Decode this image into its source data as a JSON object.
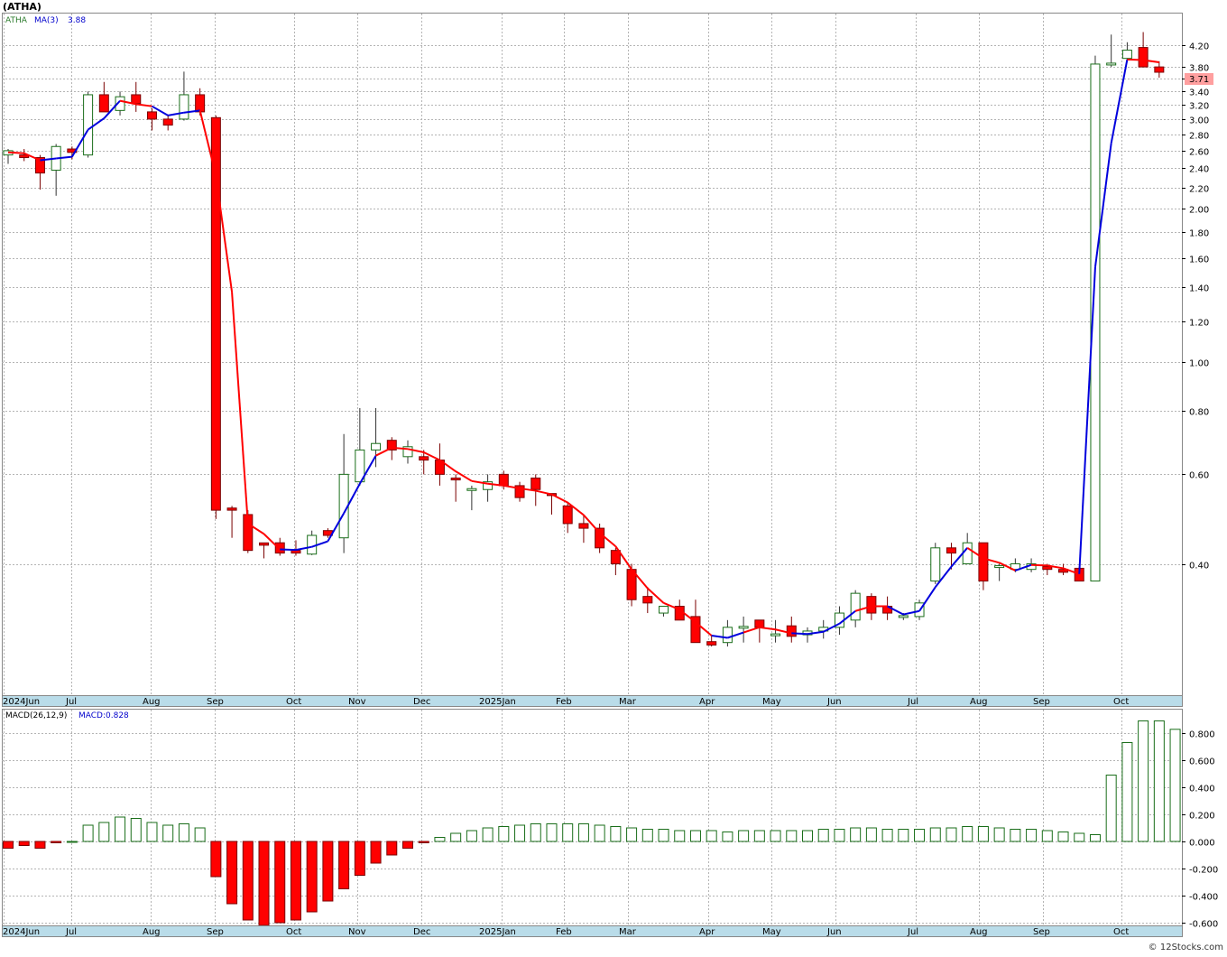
{
  "header": {
    "symbol_title": "(ATHA)",
    "legend_symbol": "ATHA",
    "legend_ma_label": "MA(3)",
    "legend_ma_value": "3.88",
    "last_price_tag": "3.71",
    "macd_label": "MACD(26,12,9)",
    "macd_value_label": "MACD:0.828",
    "watermark": "© 12Stocks.com"
  },
  "colors": {
    "up": "#1a6e1a",
    "down": "#ff0000",
    "ma_up": "#0000dd",
    "ma_down": "#ff0000",
    "grid": "#b4b4b4",
    "month_bar": "#b9dce9",
    "price_tag": "#ff9f9f"
  },
  "chart_data": [
    {
      "type": "candlestick",
      "title": "(ATHA)",
      "scale": "log",
      "interval": "weekly",
      "ylim": [
        0.27,
        4.6
      ],
      "y_ticks": [
        0.4,
        0.6,
        0.8,
        1.0,
        1.2,
        1.4,
        1.6,
        1.8,
        2.0,
        2.2,
        2.4,
        2.6,
        2.8,
        3.0,
        3.2,
        3.4,
        3.6,
        3.8,
        4.2
      ],
      "x_month_labels": [
        "2024Jun",
        "Jul",
        "Aug",
        "Sep",
        "Oct",
        "Nov",
        "Dec",
        "2025Jan",
        "Feb",
        "Mar",
        "Apr",
        "May",
        "Jun",
        "Jul",
        "Aug",
        "Sep",
        "Oct"
      ],
      "legend": [
        "ATHA",
        "MA(3) 3.88"
      ],
      "last_price": 3.71,
      "candles": [
        {
          "o": 2.55,
          "h": 2.62,
          "l": 2.45,
          "c": 2.6
        },
        {
          "o": 2.55,
          "h": 2.62,
          "l": 2.48,
          "c": 2.52
        },
        {
          "o": 2.52,
          "h": 2.55,
          "l": 2.18,
          "c": 2.35
        },
        {
          "o": 2.38,
          "h": 2.68,
          "l": 2.12,
          "c": 2.65
        },
        {
          "o": 2.62,
          "h": 2.65,
          "l": 2.5,
          "c": 2.58
        },
        {
          "o": 2.55,
          "h": 3.4,
          "l": 2.52,
          "c": 3.35
        },
        {
          "o": 3.35,
          "h": 3.55,
          "l": 3.1,
          "c": 3.1
        },
        {
          "o": 3.12,
          "h": 3.4,
          "l": 3.05,
          "c": 3.32
        },
        {
          "o": 3.35,
          "h": 3.55,
          "l": 3.1,
          "c": 3.22
        },
        {
          "o": 3.1,
          "h": 3.15,
          "l": 2.85,
          "c": 3.0
        },
        {
          "o": 3.0,
          "h": 3.05,
          "l": 2.85,
          "c": 2.92
        },
        {
          "o": 3.0,
          "h": 3.72,
          "l": 2.98,
          "c": 3.35
        },
        {
          "o": 3.35,
          "h": 3.45,
          "l": 3.05,
          "c": 3.1
        },
        {
          "o": 3.02,
          "h": 3.05,
          "l": 0.49,
          "c": 0.51
        },
        {
          "o": 0.515,
          "h": 0.52,
          "l": 0.45,
          "c": 0.51
        },
        {
          "o": 0.5,
          "h": 0.51,
          "l": 0.42,
          "c": 0.425
        },
        {
          "o": 0.438,
          "h": 0.44,
          "l": 0.41,
          "c": 0.437
        },
        {
          "o": 0.44,
          "h": 0.45,
          "l": 0.415,
          "c": 0.42
        },
        {
          "o": 0.425,
          "h": 0.445,
          "l": 0.415,
          "c": 0.42
        },
        {
          "o": 0.418,
          "h": 0.465,
          "l": 0.416,
          "c": 0.455
        },
        {
          "o": 0.465,
          "h": 0.47,
          "l": 0.45,
          "c": 0.455
        },
        {
          "o": 0.45,
          "h": 0.72,
          "l": 0.42,
          "c": 0.6
        },
        {
          "o": 0.58,
          "h": 0.81,
          "l": 0.57,
          "c": 0.67
        },
        {
          "o": 0.67,
          "h": 0.81,
          "l": 0.62,
          "c": 0.69
        },
        {
          "o": 0.7,
          "h": 0.71,
          "l": 0.64,
          "c": 0.67
        },
        {
          "o": 0.65,
          "h": 0.7,
          "l": 0.63,
          "c": 0.68
        },
        {
          "o": 0.65,
          "h": 0.67,
          "l": 0.6,
          "c": 0.64
        },
        {
          "o": 0.64,
          "h": 0.69,
          "l": 0.57,
          "c": 0.6
        },
        {
          "o": 0.59,
          "h": 0.6,
          "l": 0.53,
          "c": 0.585
        },
        {
          "o": 0.56,
          "h": 0.57,
          "l": 0.51,
          "c": 0.56
        },
        {
          "o": 0.56,
          "h": 0.6,
          "l": 0.53,
          "c": 0.58
        },
        {
          "o": 0.6,
          "h": 0.61,
          "l": 0.56,
          "c": 0.57
        },
        {
          "o": 0.57,
          "h": 0.58,
          "l": 0.53,
          "c": 0.54
        },
        {
          "o": 0.59,
          "h": 0.6,
          "l": 0.52,
          "c": 0.56
        },
        {
          "o": 0.55,
          "h": 0.55,
          "l": 0.5,
          "c": 0.545
        },
        {
          "o": 0.52,
          "h": 0.53,
          "l": 0.46,
          "c": 0.48
        },
        {
          "o": 0.48,
          "h": 0.5,
          "l": 0.44,
          "c": 0.47
        },
        {
          "o": 0.47,
          "h": 0.48,
          "l": 0.42,
          "c": 0.43
        },
        {
          "o": 0.425,
          "h": 0.43,
          "l": 0.38,
          "c": 0.4
        },
        {
          "o": 0.39,
          "h": 0.4,
          "l": 0.33,
          "c": 0.34
        },
        {
          "o": 0.345,
          "h": 0.36,
          "l": 0.32,
          "c": 0.335
        },
        {
          "o": 0.32,
          "h": 0.33,
          "l": 0.315,
          "c": 0.33
        },
        {
          "o": 0.33,
          "h": 0.34,
          "l": 0.31,
          "c": 0.31
        },
        {
          "o": 0.315,
          "h": 0.34,
          "l": 0.28,
          "c": 0.28
        },
        {
          "o": 0.28,
          "h": 0.29,
          "l": 0.275,
          "c": 0.278
        },
        {
          "o": 0.28,
          "h": 0.31,
          "l": 0.275,
          "c": 0.3
        },
        {
          "o": 0.3,
          "h": 0.315,
          "l": 0.28,
          "c": 0.3
        },
        {
          "o": 0.31,
          "h": 0.31,
          "l": 0.28,
          "c": 0.3
        },
        {
          "o": 0.29,
          "h": 0.31,
          "l": 0.28,
          "c": 0.29
        },
        {
          "o": 0.302,
          "h": 0.315,
          "l": 0.28,
          "c": 0.288
        },
        {
          "o": 0.29,
          "h": 0.3,
          "l": 0.28,
          "c": 0.295
        },
        {
          "o": 0.295,
          "h": 0.31,
          "l": 0.285,
          "c": 0.3
        },
        {
          "o": 0.3,
          "h": 0.33,
          "l": 0.29,
          "c": 0.32
        },
        {
          "o": 0.31,
          "h": 0.355,
          "l": 0.3,
          "c": 0.35
        },
        {
          "o": 0.345,
          "h": 0.35,
          "l": 0.31,
          "c": 0.32
        },
        {
          "o": 0.33,
          "h": 0.345,
          "l": 0.31,
          "c": 0.32
        },
        {
          "o": 0.315,
          "h": 0.32,
          "l": 0.31,
          "c": 0.315
        },
        {
          "o": 0.315,
          "h": 0.34,
          "l": 0.31,
          "c": 0.335
        },
        {
          "o": 0.37,
          "h": 0.44,
          "l": 0.365,
          "c": 0.43
        },
        {
          "o": 0.43,
          "h": 0.44,
          "l": 0.39,
          "c": 0.42
        },
        {
          "o": 0.4,
          "h": 0.46,
          "l": 0.4,
          "c": 0.44
        },
        {
          "o": 0.44,
          "h": 0.44,
          "l": 0.355,
          "c": 0.37
        },
        {
          "o": 0.395,
          "h": 0.4,
          "l": 0.37,
          "c": 0.395
        },
        {
          "o": 0.39,
          "h": 0.41,
          "l": 0.385,
          "c": 0.4
        },
        {
          "o": 0.39,
          "h": 0.41,
          "l": 0.385,
          "c": 0.4
        },
        {
          "o": 0.395,
          "h": 0.4,
          "l": 0.38,
          "c": 0.39
        },
        {
          "o": 0.39,
          "h": 0.4,
          "l": 0.38,
          "c": 0.385
        },
        {
          "o": 0.392,
          "h": 0.395,
          "l": 0.37,
          "c": 0.37
        },
        {
          "o": 0.37,
          "h": 4.0,
          "l": 0.37,
          "c": 3.85
        },
        {
          "o": 3.85,
          "h": 4.4,
          "l": 3.8,
          "c": 3.85
        },
        {
          "o": 3.95,
          "h": 4.25,
          "l": 3.9,
          "c": 4.1
        },
        {
          "o": 4.15,
          "h": 4.45,
          "l": 3.8,
          "c": 3.8
        },
        {
          "o": 3.8,
          "h": 3.9,
          "l": 3.62,
          "c": 3.71
        }
      ],
      "ma3": [
        2.58,
        2.57,
        2.49,
        2.51,
        2.53,
        2.86,
        3.01,
        3.26,
        3.21,
        3.18,
        3.05,
        3.09,
        3.12,
        2.32,
        1.37,
        0.48,
        0.458,
        0.427,
        0.426,
        0.432,
        0.443,
        0.503,
        0.575,
        0.653,
        0.677,
        0.673,
        0.663,
        0.64,
        0.608,
        0.582,
        0.575,
        0.57,
        0.563,
        0.557,
        0.548,
        0.528,
        0.499,
        0.46,
        0.433,
        0.39,
        0.358,
        0.335,
        0.325,
        0.307,
        0.289,
        0.286,
        0.293,
        0.3,
        0.297,
        0.292,
        0.291,
        0.294,
        0.305,
        0.323,
        0.33,
        0.33,
        0.318,
        0.323,
        0.36,
        0.395,
        0.43,
        0.41,
        0.402,
        0.388,
        0.398,
        0.397,
        0.392,
        0.382,
        1.535,
        2.69,
        3.93,
        3.92,
        3.88
      ],
      "ma3_direction": [
        "d",
        "d",
        "d",
        "u",
        "u",
        "u",
        "u",
        "u",
        "d",
        "d",
        "u",
        "u",
        "u",
        "d",
        "d",
        "d",
        "d",
        "d",
        "u",
        "u",
        "u",
        "u",
        "u",
        "u",
        "d",
        "d",
        "d",
        "d",
        "d",
        "d",
        "d",
        "d",
        "d",
        "d",
        "d",
        "d",
        "d",
        "d",
        "d",
        "d",
        "d",
        "d",
        "d",
        "d",
        "d",
        "u",
        "u",
        "d",
        "d",
        "d",
        "u",
        "u",
        "u",
        "u",
        "d",
        "d",
        "u",
        "u",
        "u",
        "u",
        "u",
        "d",
        "d",
        "d",
        "u",
        "d",
        "d",
        "d",
        "u",
        "u",
        "u",
        "d",
        "d"
      ]
    },
    {
      "type": "bar",
      "title": "MACD(26,12,9)",
      "ylim": [
        -0.62,
        0.9
      ],
      "y_ticks": [
        -0.6,
        -0.4,
        -0.2,
        0.0,
        0.2,
        0.4,
        0.6,
        0.8
      ],
      "x_month_labels": [
        "2024Jun",
        "Jul",
        "Aug",
        "Sep",
        "Oct",
        "Nov",
        "Dec",
        "2025Jan",
        "Feb",
        "Mar",
        "Apr",
        "May",
        "Jun",
        "Jul",
        "Aug",
        "Sep",
        "Oct"
      ],
      "last_value": 0.828,
      "values": [
        -0.05,
        -0.03,
        -0.05,
        -0.01,
        0.0,
        0.12,
        0.14,
        0.18,
        0.17,
        0.14,
        0.12,
        0.13,
        0.1,
        -0.26,
        -0.46,
        -0.58,
        -0.62,
        -0.6,
        -0.58,
        -0.52,
        -0.44,
        -0.35,
        -0.25,
        -0.16,
        -0.1,
        -0.05,
        -0.01,
        0.03,
        0.06,
        0.08,
        0.1,
        0.11,
        0.12,
        0.13,
        0.13,
        0.13,
        0.13,
        0.12,
        0.11,
        0.1,
        0.09,
        0.09,
        0.08,
        0.08,
        0.08,
        0.07,
        0.08,
        0.08,
        0.08,
        0.08,
        0.08,
        0.09,
        0.09,
        0.1,
        0.1,
        0.09,
        0.09,
        0.09,
        0.1,
        0.1,
        0.11,
        0.11,
        0.1,
        0.09,
        0.09,
        0.08,
        0.07,
        0.06,
        0.05,
        0.49,
        0.73,
        0.89,
        0.89,
        0.828
      ]
    }
  ]
}
